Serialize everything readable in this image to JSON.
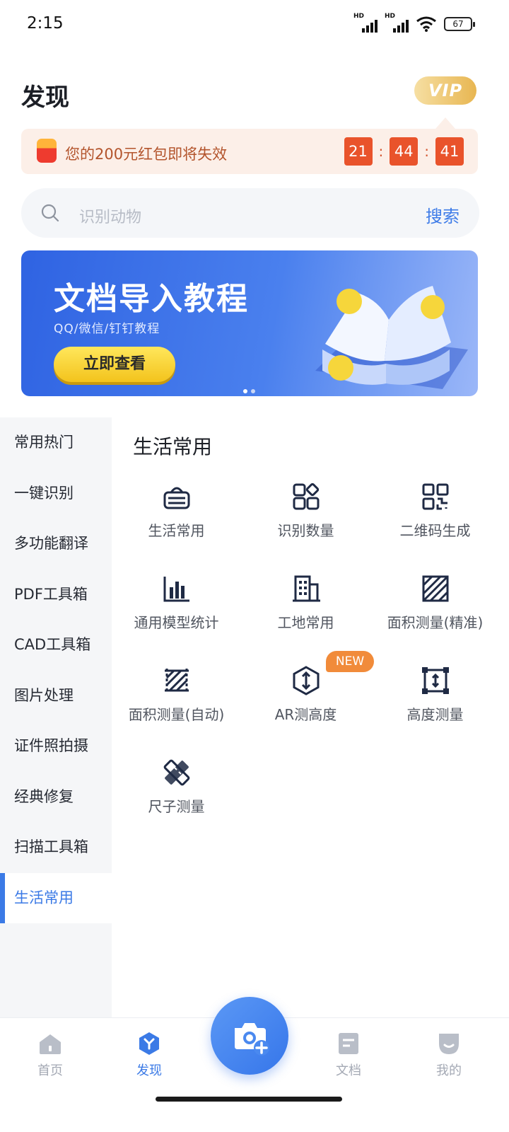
{
  "status_bar": {
    "time": "2:15",
    "battery": "67",
    "hd_label": "HD"
  },
  "header": {
    "title": "发现",
    "vip_label": "VIP"
  },
  "coupon": {
    "text": "您的200元红包即将失效",
    "hours": "21",
    "minutes": "44",
    "seconds": "41",
    "separator": ":"
  },
  "search": {
    "placeholder": "识别动物",
    "button_label": "搜索"
  },
  "banner": {
    "title": "文档导入教程",
    "subtitle": "QQ/微信/钉钉教程",
    "button_label": "立即查看",
    "active_slide": 1,
    "slide_count": 2
  },
  "sidebar": {
    "items": [
      {
        "label": "常用热门"
      },
      {
        "label": "一键识别"
      },
      {
        "label": "多功能翻译"
      },
      {
        "label": "PDF工具箱"
      },
      {
        "label": "CAD工具箱"
      },
      {
        "label": "图片处理"
      },
      {
        "label": "证件照拍摄"
      },
      {
        "label": "经典修复"
      },
      {
        "label": "扫描工具箱"
      },
      {
        "label": "生活常用"
      }
    ],
    "active_index": 9
  },
  "section": {
    "title": "生活常用",
    "tools": [
      {
        "label": "生活常用",
        "icon": "basket-icon"
      },
      {
        "label": "识别数量",
        "icon": "apps-grid-icon"
      },
      {
        "label": "二维码生成",
        "icon": "qr-code-icon"
      },
      {
        "label": "通用模型统计",
        "icon": "bar-chart-icon"
      },
      {
        "label": "工地常用",
        "icon": "building-icon"
      },
      {
        "label": "面积测量(精准)",
        "icon": "area-hatch-icon"
      },
      {
        "label": "面积测量(自动)",
        "icon": "area-auto-icon"
      },
      {
        "label": "AR测高度",
        "icon": "ar-height-icon",
        "badge": "NEW"
      },
      {
        "label": "高度测量",
        "icon": "height-measure-icon"
      },
      {
        "label": "尺子测量",
        "icon": "ruler-icon"
      }
    ]
  },
  "bottom_nav": {
    "items": [
      {
        "label": "首页",
        "icon": "home-icon"
      },
      {
        "label": "发现",
        "icon": "discover-icon"
      },
      {
        "label": "文档",
        "icon": "document-icon"
      },
      {
        "label": "我的",
        "icon": "profile-icon"
      }
    ],
    "active_index": 1,
    "camera_icon": "camera-add-icon"
  },
  "colors": {
    "accent": "#3b7ae6",
    "countdown": "#e9532b",
    "vip_gold": "#e8b651",
    "icon_ink": "#1f2a44"
  }
}
